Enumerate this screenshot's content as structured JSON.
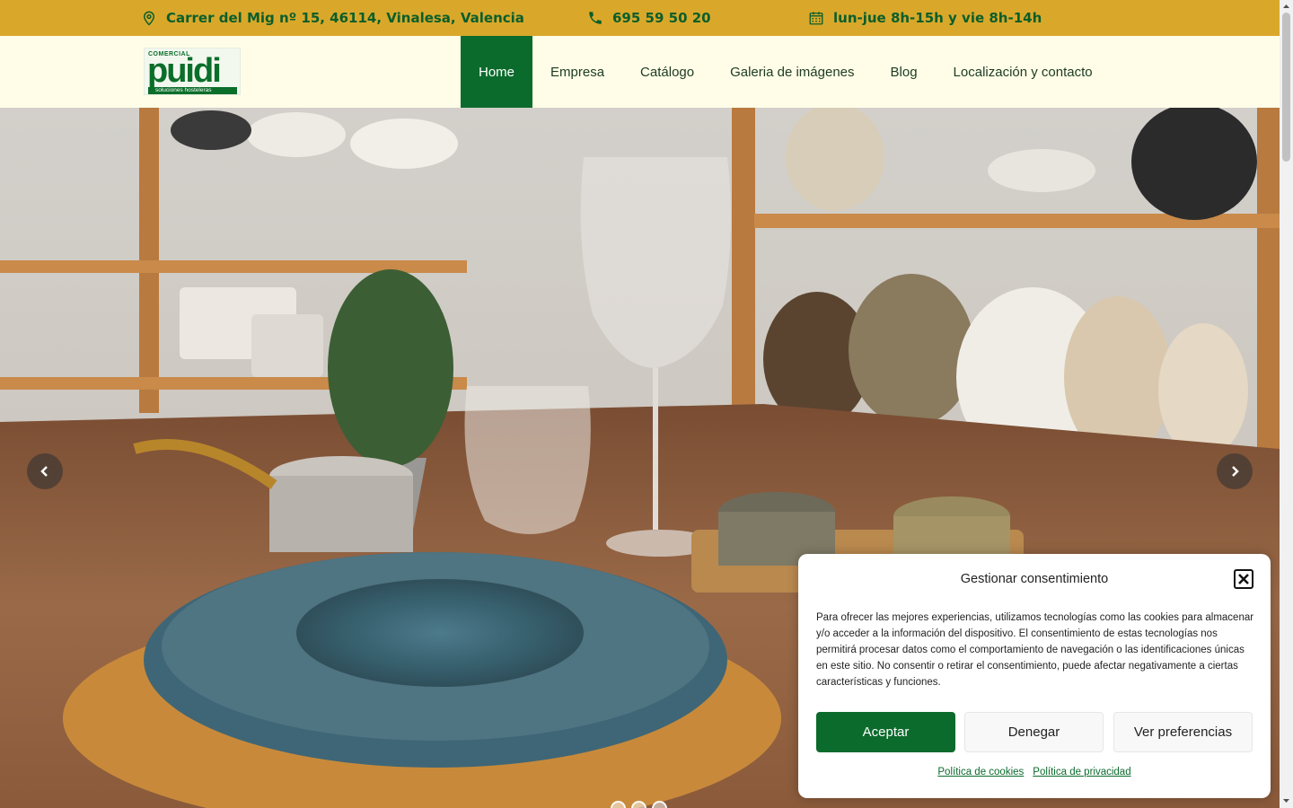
{
  "topbar": {
    "address": "Carrer del Mig nº 15, 46114, Vinalesa, Valencia",
    "phone": "695 59 50 20",
    "hours": "lun-jue 8h-15h y vie 8h-14h",
    "icons": [
      "map-pin-icon",
      "phone-icon",
      "calendar-icon"
    ]
  },
  "logo": {
    "top_text": "COMERCIAL",
    "main_text": "puidi",
    "sub_text": "soluciones hosteleras"
  },
  "nav": {
    "items": [
      {
        "label": "Home",
        "active": true
      },
      {
        "label": "Empresa",
        "active": false
      },
      {
        "label": "Catálogo",
        "active": false
      },
      {
        "label": "Galeria de imágenes",
        "active": false
      },
      {
        "label": "Blog",
        "active": false
      },
      {
        "label": "Localización y contacto",
        "active": false
      }
    ]
  },
  "slider": {
    "slides_count": 3,
    "active_slide": 1
  },
  "cookie": {
    "title": "Gestionar consentimiento",
    "body": "Para ofrecer las mejores experiencias, utilizamos tecnologías como las cookies para almacenar y/o acceder a la información del dispositivo. El consentimiento de estas tecnologías nos permitirá procesar datos como el comportamiento de navegación o las identificaciones únicas en este sitio. No consentir o retirar el consentimiento, puede afectar negativamente a ciertas características y funciones.",
    "accept": "Aceptar",
    "deny": "Denegar",
    "preferences": "Ver preferencias",
    "cookie_policy": "Política de cookies",
    "privacy_policy": "Política de privacidad"
  },
  "colors": {
    "topbar_bg": "#d9a82a",
    "brand_green": "#0b6b2c",
    "header_bg": "#fffde8"
  }
}
